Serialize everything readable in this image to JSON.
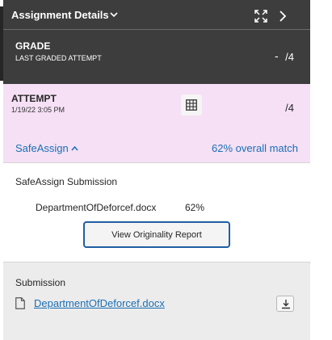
{
  "header": {
    "title": "Assignment Details",
    "icons": [
      "chevron-down-icon",
      "expand-icon",
      "chevron-right-icon"
    ]
  },
  "grade": {
    "label": "GRADE",
    "sublabel": "LAST GRADED ATTEMPT",
    "value": "-",
    "out_of": "/4"
  },
  "attempt": {
    "label": "ATTEMPT",
    "datetime": "1/19/22 3:05 PM",
    "out_of": "/4",
    "rubric_icon": "grid-icon"
  },
  "safeassign": {
    "toggle_label": "SafeAssign",
    "overall_match": "62% overall match",
    "section_title": "SafeAssign Submission",
    "file_name": "DepartmentOfDeforcef.docx",
    "file_match": "62%",
    "report_button": "View Originality Report"
  },
  "submission": {
    "title": "Submission",
    "file_link": "DepartmentOfDeforcef.docx",
    "icons": [
      "document-icon",
      "download-icon"
    ]
  },
  "colors": {
    "header_bg": "#3d3d3d",
    "attempt_bg": "#f5e0f5",
    "link": "#1a6fb5",
    "button_border": "#1f5fa3",
    "panel_bg": "#ececec"
  }
}
